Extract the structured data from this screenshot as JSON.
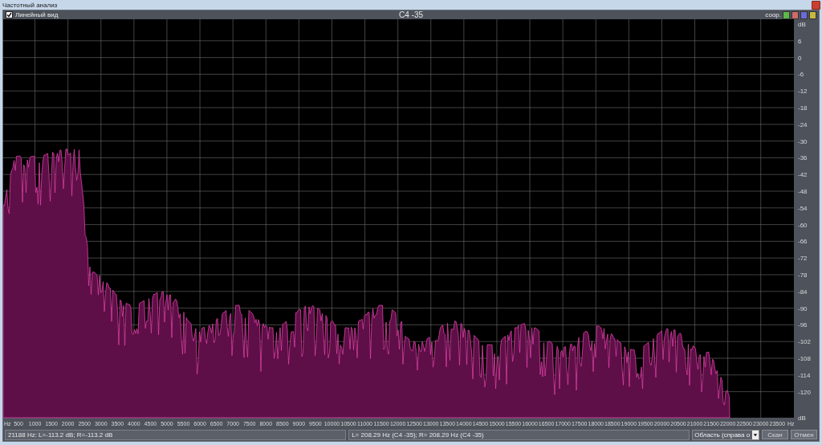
{
  "window": {
    "title": "Частотный анализ"
  },
  "toolbar": {
    "checkbox": {
      "label": "Линейный вид",
      "checked": true
    },
    "title": "C4 -35",
    "hold_label": "соор.",
    "hold_buttons": [
      {
        "color": "#5cb848"
      },
      {
        "color": "#d06a6a"
      },
      {
        "color": "#6a6ad8"
      },
      {
        "color": "#c8b840"
      }
    ]
  },
  "y_ticks": [
    "dB",
    "6",
    "0",
    "-6",
    "-12",
    "-18",
    "-24",
    "-30",
    "-36",
    "-42",
    "-48",
    "-54",
    "-60",
    "-66",
    "-72",
    "-78",
    "-84",
    "-90",
    "-96",
    "-102",
    "-108",
    "-114",
    "-120",
    "dB"
  ],
  "x_ticks": [
    "Hz",
    "500",
    "1000",
    "1500",
    "2000",
    "2500",
    "3000",
    "3500",
    "4000",
    "4500",
    "5000",
    "5500",
    "6000",
    "6500",
    "7000",
    "7500",
    "8000",
    "8500",
    "9000",
    "9500",
    "10000",
    "10500",
    "11000",
    "11500",
    "12000",
    "12500",
    "13000",
    "13500",
    "14000",
    "14500",
    "15000",
    "15500",
    "16000",
    "16500",
    "17000",
    "17500",
    "18000",
    "18500",
    "19000",
    "19500",
    "20000",
    "20500",
    "21000",
    "21500",
    "22000",
    "22500",
    "23000",
    "23500",
    "Hz"
  ],
  "status_bar": {
    "cursor": "21188 Hz: L=-113.2 dB; R=-113.2 dB",
    "peak": "L= 208.29 Hz (C4 -35); R= 208.29 Hz (C4 -35)",
    "range_select": "Область (справа о",
    "buttons": [
      "Скан",
      "Отмен"
    ]
  }
}
